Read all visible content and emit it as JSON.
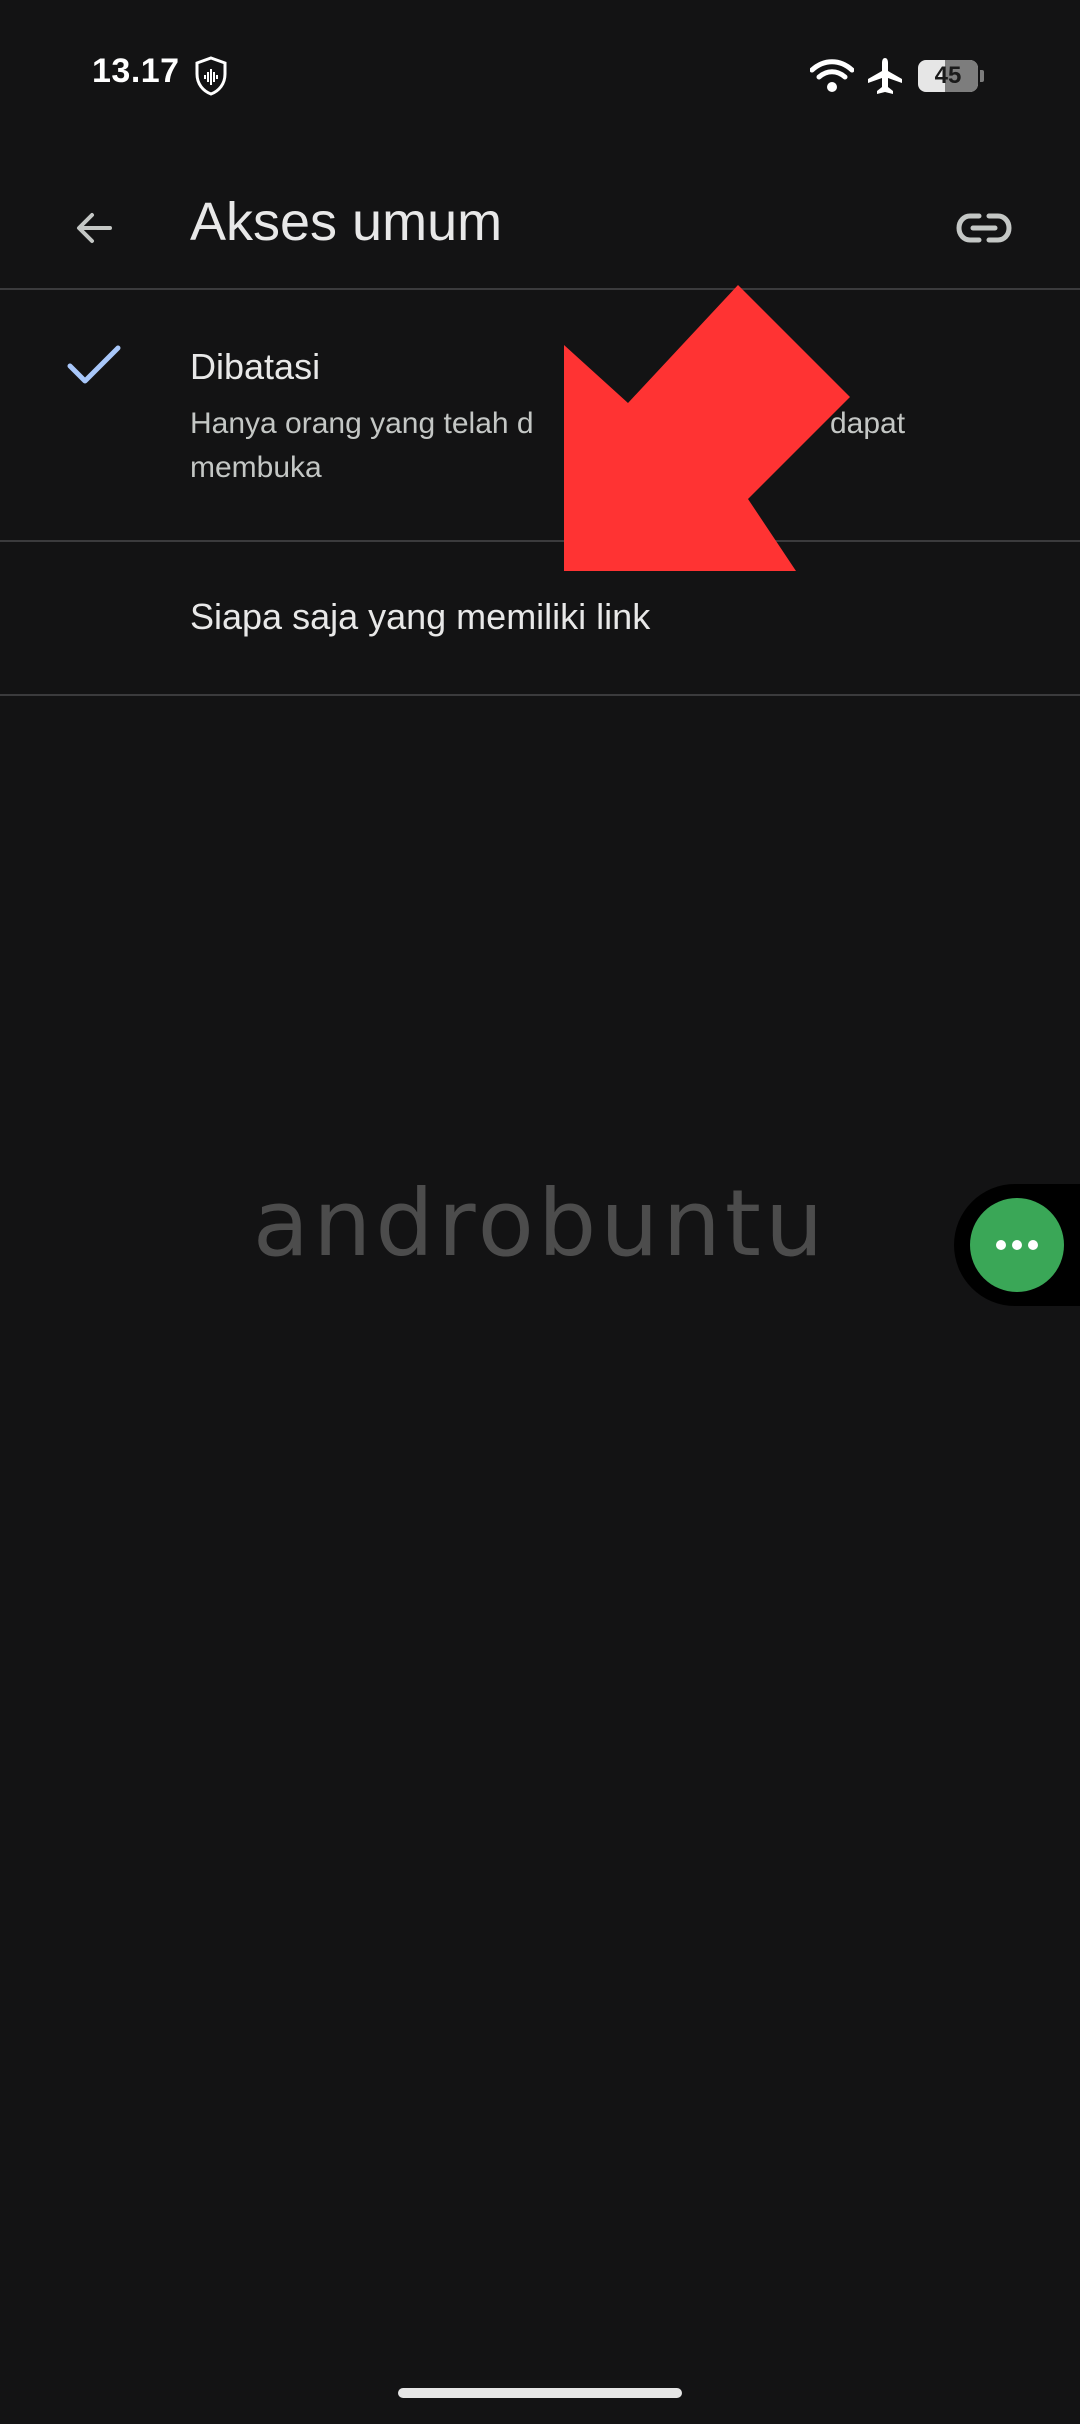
{
  "status_bar": {
    "time": "13.17",
    "battery": "45",
    "battery_level_percent": 45
  },
  "app_bar": {
    "title": "Akses umum",
    "back_icon": "arrow-back-icon",
    "link_icon": "link-icon"
  },
  "options": [
    {
      "title": "Dibatasi",
      "description": "Hanya orang yang telah d... dapat membuka",
      "description_visible_left": "Hanya orang yang telah d",
      "description_visible_right": "dapat",
      "description_line2": "membuka",
      "selected": true
    },
    {
      "title": "Siapa saja yang memiliki link",
      "selected": false
    }
  ],
  "watermark": "androbuntu",
  "floating_bubble": {
    "icon": "more-horiz-icon",
    "color": "#3aa757"
  },
  "colors": {
    "background": "#131314",
    "accent_check": "#a8c7fa",
    "annotation_arrow": "#ff3333"
  }
}
